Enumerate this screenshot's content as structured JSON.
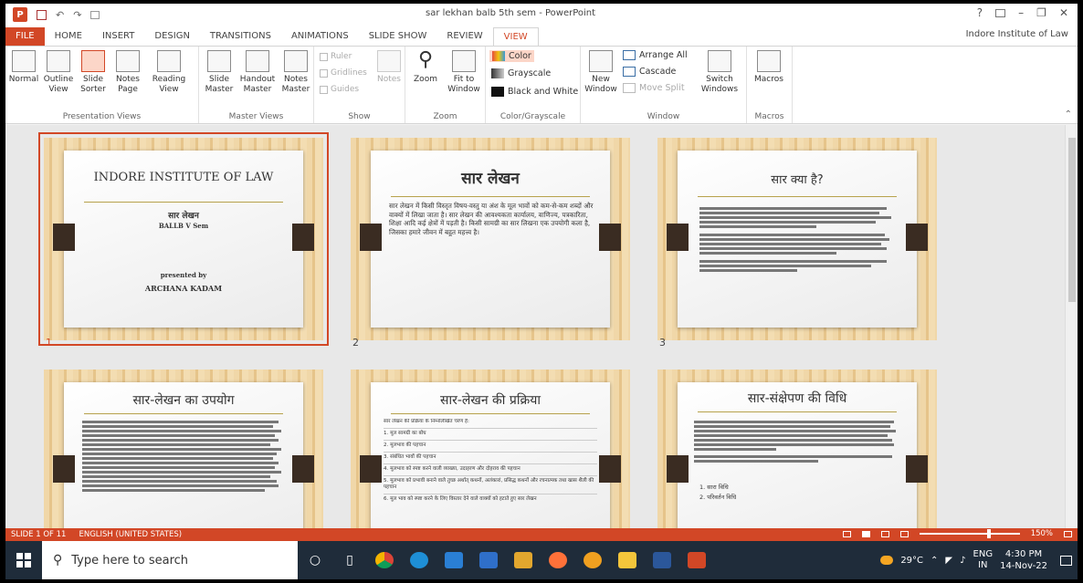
{
  "titlebar": {
    "title": "sar lekhan balb 5th sem - PowerPoint",
    "help": "?",
    "minimize": "–",
    "restore": "❐",
    "close": "✕",
    "undo": "↶",
    "redo": "↷",
    "account": "Indore Institute of Law"
  },
  "tabs": [
    "FILE",
    "HOME",
    "INSERT",
    "DESIGN",
    "TRANSITIONS",
    "ANIMATIONS",
    "SLIDE SHOW",
    "REVIEW",
    "VIEW"
  ],
  "ribbon": {
    "presentation_views": {
      "label": "Presentation Views",
      "buttons": [
        {
          "l1": "Normal",
          "l2": ""
        },
        {
          "l1": "Outline",
          "l2": "View"
        },
        {
          "l1": "Slide",
          "l2": "Sorter"
        },
        {
          "l1": "Notes",
          "l2": "Page"
        },
        {
          "l1": "Reading",
          "l2": "View"
        }
      ]
    },
    "master_views": {
      "label": "Master Views",
      "buttons": [
        {
          "l1": "Slide",
          "l2": "Master"
        },
        {
          "l1": "Handout",
          "l2": "Master"
        },
        {
          "l1": "Notes",
          "l2": "Master"
        }
      ]
    },
    "show": {
      "label": "Show",
      "checks": [
        "Ruler",
        "Gridlines",
        "Guides"
      ],
      "notes": "Notes"
    },
    "zoom": {
      "label": "Zoom",
      "zoom": "Zoom",
      "fit1": "Fit to",
      "fit2": "Window"
    },
    "color": {
      "label": "Color/Grayscale",
      "items": [
        "Color",
        "Grayscale",
        "Black and White"
      ]
    },
    "window": {
      "label": "Window",
      "new1": "New",
      "new2": "Window",
      "arrange": "Arrange All",
      "cascade": "Cascade",
      "movesplit": "Move Split",
      "switch1": "Switch",
      "switch2": "Windows"
    },
    "macros": {
      "label": "Macros",
      "btn": "Macros"
    }
  },
  "slides": [
    {
      "num": "1",
      "title": "INDORE INSTITUTE OF LAW",
      "sub1": "सार लेखन",
      "sub2": "BALLB V Sem",
      "by1": "presented by",
      "by2": "ARCHANA KADAM"
    },
    {
      "num": "2",
      "title": "सार लेखन",
      "body": "सार लेखन में किसी विस्तृत विषय-वस्तु या अंश के मूल भावों को कम-से-कम शब्दों और वाक्यों में लिखा जाता है। सार लेखन की आवश्यकता कार्यालय, वाणिज्य, पत्रकारिता, शिक्षा आदि कई क्षेत्रों में पड़ती है। किसी सामग्री का सार लिखना एक उपयोगी कला है, जिसका हमारे जीवन में बहुत महत्त्व है।"
    },
    {
      "num": "3",
      "title": "सार क्या है?"
    },
    {
      "num": "",
      "title": "सार-लेखन का उपयोग"
    },
    {
      "num": "",
      "title": "सार-लेखन की प्रक्रिया",
      "steps": [
        "सार लेखन की प्रक्रिया के निम्नलिखित चरण हैं:",
        "1. मूल सामग्री का बोध",
        "2. मूलभाव की पहचान",
        "3. संबंधित भावों की पहचान",
        "4. मूलभाव को स्पष्ट करने वाली व्याख्या, उदाहरण और दोहराव की पहचान",
        "5. मूलभाव को प्रभावी बनाने वाले तुच्छ अर्थात् कथनों, अलंकारां, प्रसिद्ध कथनों और रचनात्मक तथा खास शैली की पहचान",
        "6. मूल भाव को स्पष्ट करने के लिए विस्तार देने वाले वाक्यों को हटाते हुए सार लेखन"
      ]
    },
    {
      "num": "",
      "title": "सार-संक्षेपण की विधि",
      "list": [
        "1. सारा विधि",
        "2. परिवर्तन विधि"
      ]
    }
  ],
  "status": {
    "slide": "SLIDE 1 OF 11",
    "lang": "ENGLISH (UNITED STATES)",
    "zoom": "150%"
  },
  "taskbar": {
    "search": "Type here to search",
    "temp": "29°C",
    "lang1": "ENG",
    "lang2": "IN",
    "time": "4:30 PM",
    "date": "14-Nov-22"
  }
}
